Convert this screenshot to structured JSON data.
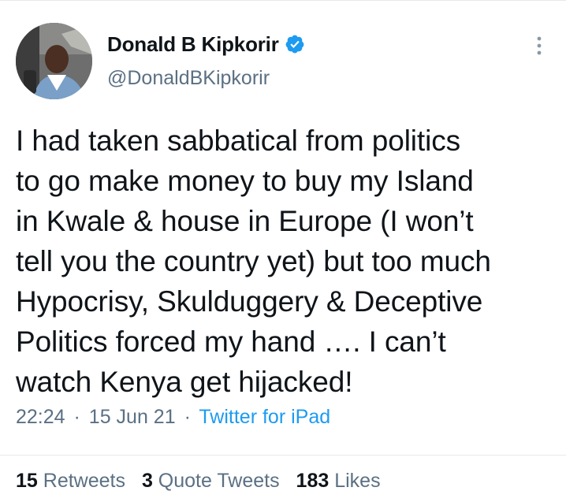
{
  "author": {
    "display_name": "Donald B Kipkorir",
    "handle": "@DonaldBKipkorir",
    "verified": true
  },
  "tweet": {
    "text": "I had taken sabbatical from politics\nto go make money to buy my Island\nin Kwale & house in Europe (I won’t\ntell you the country yet) but too much\nHypocrisy, Skulduggery & Deceptive\nPolitics forced my hand …. I can’t\nwatch Kenya get hijacked!",
    "time": "22:24",
    "date": "15 Jun 21",
    "source": "Twitter for iPad",
    "separator": "·"
  },
  "stats": {
    "retweets_count": "15",
    "retweets_label": "Retweets",
    "quote_tweets_count": "3",
    "quote_tweets_label": "Quote Tweets",
    "likes_count": "183",
    "likes_label": "Likes"
  },
  "icons": {
    "verified": "verified-badge-icon",
    "more": "more-options-icon"
  },
  "colors": {
    "accent": "#1d9bf0",
    "text": "#0f1419",
    "muted": "#5b7083"
  }
}
